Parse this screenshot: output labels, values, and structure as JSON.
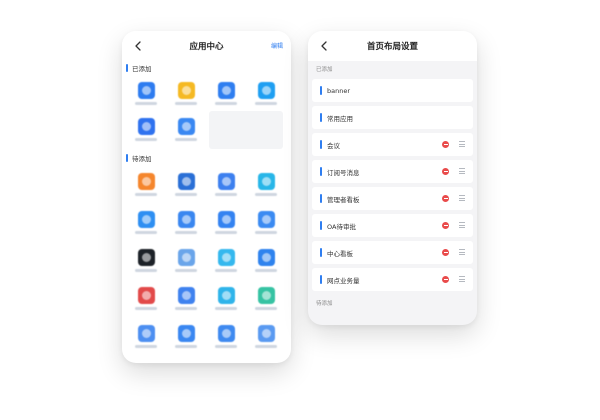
{
  "left": {
    "title": "应用中心",
    "edit_label": "编辑",
    "added_label": "已添加",
    "pending_label": "待添加",
    "added_apps": [
      {
        "icon": "compass-app-icon",
        "color": "#2e7cf0"
      },
      {
        "icon": "folder-app-icon",
        "color": "#f5b923"
      },
      {
        "icon": "store-app-icon",
        "color": "#2f7ef0"
      },
      {
        "icon": "currency-app-icon",
        "color": "#1f9ff2"
      },
      {
        "icon": "chat-app-icon",
        "color": "#2f72ef"
      },
      {
        "icon": "screen-app-icon",
        "color": "#3a88f2"
      }
    ],
    "pending_apps": [
      {
        "icon": "orange-app-icon",
        "color": "#f5862d"
      },
      {
        "icon": "photo-app-icon",
        "color": "#2a6fd6"
      },
      {
        "icon": "blue-app-icon",
        "color": "#3d80ef"
      },
      {
        "icon": "cyan-app-icon",
        "color": "#28b6e8"
      },
      {
        "icon": "list-app-icon",
        "color": "#2e8ff2"
      },
      {
        "icon": "grid-app-icon",
        "color": "#3a87f0"
      },
      {
        "icon": "phone-app-icon",
        "color": "#3483f1"
      },
      {
        "icon": "scan-app-icon",
        "color": "#3b8bf2"
      },
      {
        "icon": "dark-app-icon",
        "color": "#1d2228"
      },
      {
        "icon": "sphere-app-icon",
        "color": "#6aa5ea"
      },
      {
        "icon": "cloud-app-icon",
        "color": "#35b8ee"
      },
      {
        "icon": "doc-app-icon",
        "color": "#2f83ee"
      },
      {
        "icon": "red-app-icon",
        "color": "#e24a4a"
      },
      {
        "icon": "gear-app-icon",
        "color": "#3f82ef"
      },
      {
        "icon": "bubble-app-icon",
        "color": "#2fb4ea"
      },
      {
        "icon": "green-app-icon",
        "color": "#36c3a3"
      },
      {
        "icon": "user-app-icon",
        "color": "#4d8ff1"
      },
      {
        "icon": "calendar-app-icon",
        "color": "#3a87f1"
      },
      {
        "icon": "mail-app-icon",
        "color": "#3f8af0"
      },
      {
        "icon": "chart-app-icon",
        "color": "#5a9af1"
      }
    ]
  },
  "right": {
    "title": "首页布局设置",
    "added_label": "已添加",
    "pending_label": "待添加",
    "fixed_items": [
      "banner",
      "常用应用"
    ],
    "items": [
      "会议",
      "订阅号消息",
      "管理者看板",
      "OA待审批",
      "中心看板",
      "网点业务量"
    ]
  },
  "colors": {
    "accent": "#2f7ef0",
    "remove": "#e94b4b"
  }
}
